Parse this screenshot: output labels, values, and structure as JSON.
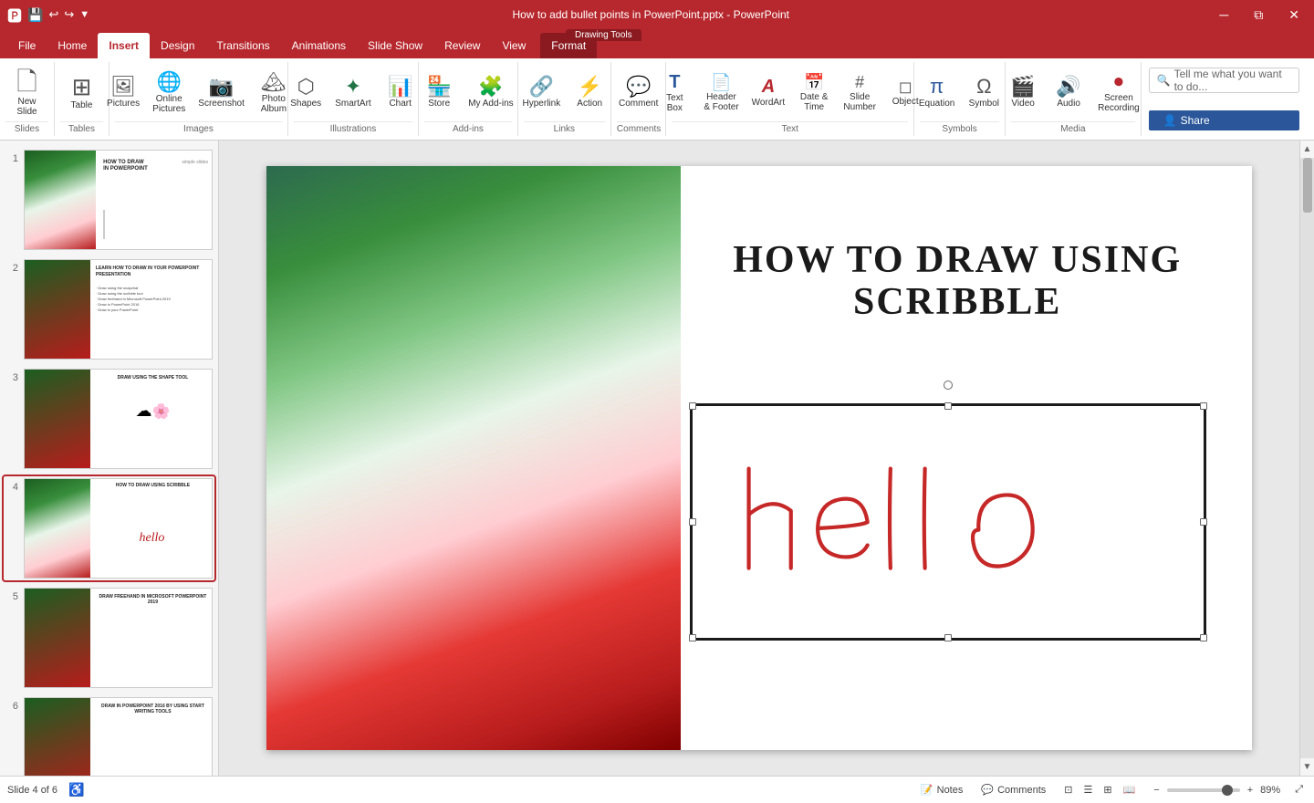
{
  "titleBar": {
    "icons": [
      "save",
      "undo",
      "redo",
      "customize"
    ],
    "title": "How to add bullet points in PowerPoint.pptx - PowerPoint",
    "windowControls": [
      "minimize",
      "restore",
      "close"
    ],
    "drawingToolsLabel": "Drawing Tools"
  },
  "ribbonTabs": {
    "tabs": [
      "File",
      "Home",
      "Insert",
      "Design",
      "Transitions",
      "Animations",
      "Slide Show",
      "Review",
      "View",
      "Format"
    ],
    "activeTab": "Insert",
    "formatTab": "Format",
    "drawingToolsLabel": "Drawing Tools"
  },
  "ribbon": {
    "groups": [
      {
        "label": "Slides",
        "items": [
          {
            "icon": "🗋",
            "label": "New\nSlide",
            "large": true
          }
        ]
      },
      {
        "label": "Tables",
        "items": [
          {
            "icon": "⊞",
            "label": "Table"
          }
        ]
      },
      {
        "label": "Images",
        "items": [
          {
            "icon": "🖼",
            "label": "Pictures"
          },
          {
            "icon": "🌐",
            "label": "Online\nPictures"
          },
          {
            "icon": "📷",
            "label": "Screenshot"
          },
          {
            "icon": "🏔",
            "label": "Photo\nAlbum"
          }
        ]
      },
      {
        "label": "Illustrations",
        "items": [
          {
            "icon": "⬡",
            "label": "Shapes"
          },
          {
            "icon": "✦",
            "label": "SmartArt"
          },
          {
            "icon": "📊",
            "label": "Chart"
          }
        ]
      },
      {
        "label": "Add-ins",
        "items": [
          {
            "icon": "🏪",
            "label": "Store"
          },
          {
            "icon": "🧩",
            "label": "My Add-ins"
          }
        ]
      },
      {
        "label": "Links",
        "items": [
          {
            "icon": "🔗",
            "label": "Hyperlink"
          },
          {
            "icon": "⚡",
            "label": "Action"
          }
        ]
      },
      {
        "label": "Comments",
        "items": [
          {
            "icon": "💬",
            "label": "Comment"
          }
        ]
      },
      {
        "label": "Text",
        "items": [
          {
            "icon": "T",
            "label": "Text\nBox"
          },
          {
            "icon": "📄",
            "label": "Header\n& Footer"
          },
          {
            "icon": "A",
            "label": "WordArt"
          },
          {
            "icon": "📅",
            "label": "Date &\nTime"
          },
          {
            "icon": "#",
            "label": "Slide\nNumber"
          },
          {
            "icon": "◻",
            "label": "Object"
          }
        ]
      },
      {
        "label": "Symbols",
        "items": [
          {
            "icon": "π",
            "label": "Equation"
          },
          {
            "icon": "Ω",
            "label": "Symbol"
          }
        ]
      },
      {
        "label": "Media",
        "items": [
          {
            "icon": "🎬",
            "label": "Video"
          },
          {
            "icon": "🔊",
            "label": "Audio"
          },
          {
            "icon": "⏺",
            "label": "Screen\nRecording"
          }
        ]
      }
    ],
    "searchPlaceholder": "Tell me what you want to do...",
    "shareLabel": "Share"
  },
  "slidePanel": {
    "slides": [
      {
        "num": "1",
        "title": "HOW TO DRAW\nIN POWERPOINT",
        "subtitle": "simple slides"
      },
      {
        "num": "2",
        "title": "LEARN HOW TO DRAW IN YOUR POWERPOINT PRESENTATION",
        "bullets": [
          "Draw using the snapchat",
          "Draw using the scribble tool",
          "Draw freehand in Microsoft PowerPoint 2019",
          "Draw in PowerPoint 2016 by using start writing tools",
          "Draw in your PowerPoint during presentation"
        ]
      },
      {
        "num": "3",
        "title": "DRAW USING THE SHAPE TOOL"
      },
      {
        "num": "4",
        "title": "HOW TO DRAW USING SCRIBBLE",
        "active": true
      },
      {
        "num": "5",
        "title": "DRAW FREEHAND IN MICROSOFT POWERPOINT 2019"
      },
      {
        "num": "6",
        "title": "DRAW IN POWERPOINT 2016 BY USING START WRITING TOOLS"
      }
    ]
  },
  "mainSlide": {
    "title": "HOW TO DRAW USING\nSCRIBBLE",
    "drawingText": "hello"
  },
  "statusBar": {
    "slideInfo": "Slide 4 of 6",
    "notes": "Notes",
    "comments": "Comments",
    "zoom": "89%",
    "viewButtons": [
      "normal",
      "outline",
      "slide-sorter",
      "reading"
    ]
  }
}
